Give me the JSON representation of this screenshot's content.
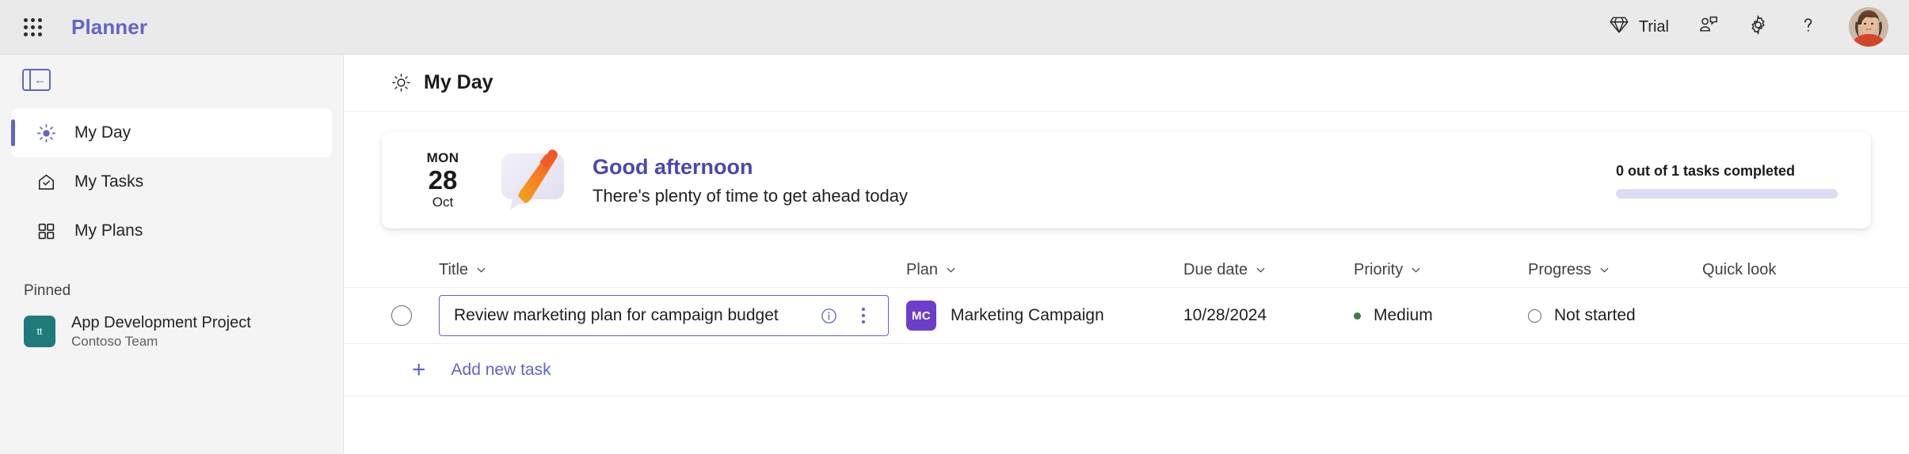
{
  "topbar": {
    "waffle_title": "App launcher",
    "brand": "Planner",
    "trial_label": "Trial",
    "icons": {
      "diamond": "diamond-icon",
      "feedback": "feedback-person-icon",
      "settings": "gear-icon",
      "help": "question-mark-icon",
      "avatar": "user-avatar"
    }
  },
  "sidebar": {
    "collapse_label": "Collapse navigation",
    "items": [
      {
        "label": "My Day",
        "icon": "sun-icon",
        "selected": true
      },
      {
        "label": "My Tasks",
        "icon": "home-check-icon",
        "selected": false
      },
      {
        "label": "My Plans",
        "icon": "grid-squares-icon",
        "selected": false
      }
    ],
    "pinned_heading": "Pinned",
    "pinned": [
      {
        "name": "App Development Project",
        "subtitle": "Contoso Team",
        "badge": "tt",
        "badge_color": "#1F7A7A"
      }
    ]
  },
  "main": {
    "page_title": "My Day",
    "page_icon": "sun-icon",
    "banner": {
      "date_dow": "MON",
      "date_day": "28",
      "date_month": "Oct",
      "greeting": "Good afternoon",
      "subtitle": "There's plenty of time to get ahead today",
      "progress_label": "0 out of 1 tasks completed",
      "progress_percent": 0
    },
    "columns": [
      {
        "label": "Title",
        "sortable": true
      },
      {
        "label": "Plan",
        "sortable": true
      },
      {
        "label": "Due date",
        "sortable": true
      },
      {
        "label": "Priority",
        "sortable": true
      },
      {
        "label": "Progress",
        "sortable": true
      },
      {
        "label": "Quick look",
        "sortable": false
      }
    ],
    "tasks": [
      {
        "title": "Review marketing plan for campaign budget",
        "plan": "Marketing Campaign",
        "plan_badge": "MC",
        "plan_badge_color": "#6B3FC9",
        "due_date": "10/28/2024",
        "priority": "Medium",
        "priority_color": "#3E7A45",
        "progress": "Not started",
        "completed": false
      }
    ],
    "add_task_label": "Add new task"
  },
  "theme": {
    "accent": "#6264C7",
    "greeting_color": "#4A47B1",
    "sidebar_bg": "#F4F4F4",
    "topbar_bg": "#EAEAEA"
  }
}
